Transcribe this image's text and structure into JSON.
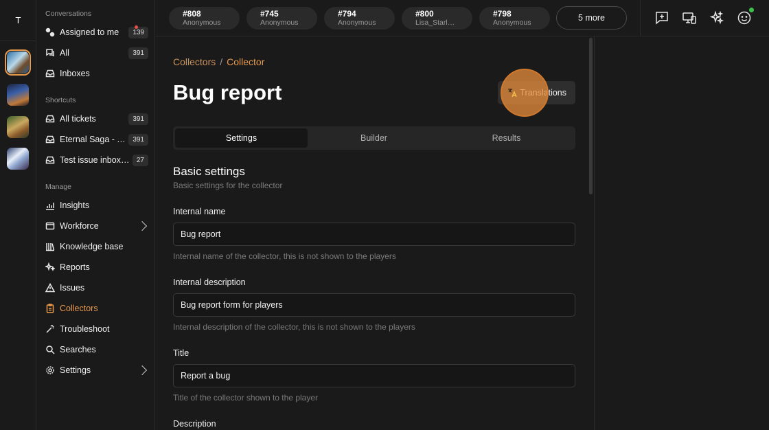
{
  "workspace": {
    "initial": "T"
  },
  "sidebar": {
    "sections": {
      "conversations": "Conversations",
      "shortcuts": "Shortcuts",
      "manage": "Manage"
    },
    "conversations": [
      {
        "label": "Assigned to me",
        "count": "139"
      },
      {
        "label": "All",
        "count": "391"
      },
      {
        "label": "Inboxes"
      }
    ],
    "shortcuts": [
      {
        "label": "All tickets",
        "count": "391"
      },
      {
        "label": "Eternal Saga - Ticke…",
        "count": "391"
      },
      {
        "label": "Test issue inbox only",
        "count": "27"
      }
    ],
    "manage": [
      {
        "label": "Insights"
      },
      {
        "label": "Workforce"
      },
      {
        "label": "Knowledge base"
      },
      {
        "label": "Reports"
      },
      {
        "label": "Issues"
      },
      {
        "label": "Collectors"
      },
      {
        "label": "Troubleshoot"
      },
      {
        "label": "Searches"
      },
      {
        "label": "Settings"
      }
    ]
  },
  "topbar": {
    "tickets": [
      {
        "num": "#808",
        "who": "Anonymous"
      },
      {
        "num": "#745",
        "who": "Anonymous"
      },
      {
        "num": "#794",
        "who": "Anonymous"
      },
      {
        "num": "#800",
        "who": "Lisa_Starlight"
      },
      {
        "num": "#798",
        "who": "Anonymous"
      }
    ],
    "more_label": "5 more"
  },
  "breadcrumb": {
    "parent": "Collectors",
    "separator": "/",
    "current": "Collector"
  },
  "page": {
    "title": "Bug report",
    "translations_label": "Translations"
  },
  "tabs": [
    "Settings",
    "Builder",
    "Results"
  ],
  "basic": {
    "heading": "Basic settings",
    "subheading": "Basic settings for the collector",
    "fields": [
      {
        "label": "Internal name",
        "value": "Bug report",
        "help": "Internal name of the collector, this is not shown to the players"
      },
      {
        "label": "Internal description",
        "value": "Bug report form for players",
        "help": "Internal description of the collector, this is not shown to the players"
      },
      {
        "label": "Title",
        "value": "Report a bug",
        "help": "Title of the collector shown to the player"
      },
      {
        "label": "Description"
      }
    ]
  },
  "colors": {
    "accent": "#e89a4c",
    "background": "#1a1a1a",
    "online": "#3cc24a"
  }
}
